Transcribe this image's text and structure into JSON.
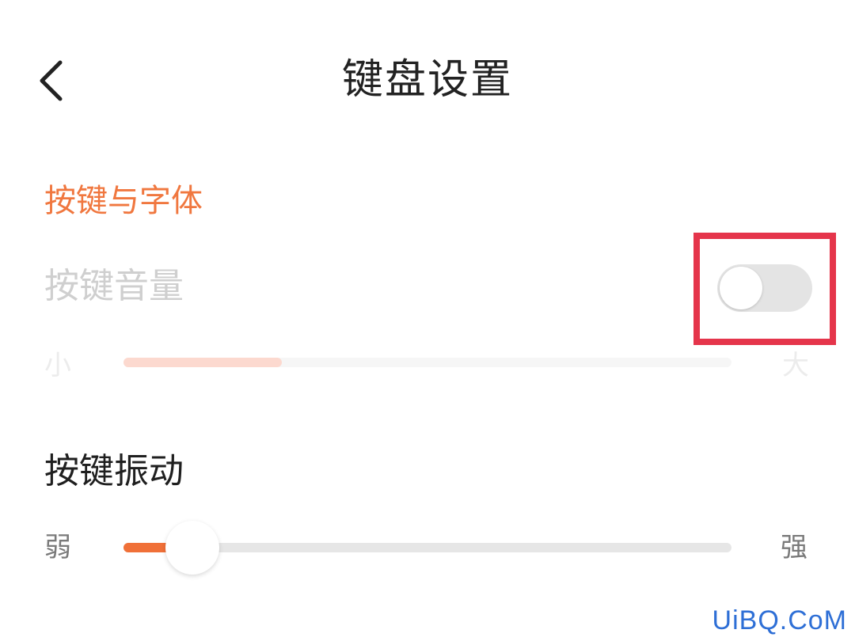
{
  "header": {
    "title": "键盘设置",
    "back_icon": "chevron-left-icon"
  },
  "section": {
    "title": "按键与字体",
    "color": "#f0773f"
  },
  "key_volume": {
    "label": "按键音量",
    "toggle_on": false,
    "slider_min_label": "小",
    "slider_max_label": "大",
    "slider_level": 0.26
  },
  "key_vibration": {
    "label": "按键振动",
    "slider_min_label": "弱",
    "slider_max_label": "强",
    "slider_level": 0.1
  },
  "highlight_color": "#e5354b",
  "accent_color": "#f07038",
  "watermark": "UiBQ.CoM"
}
